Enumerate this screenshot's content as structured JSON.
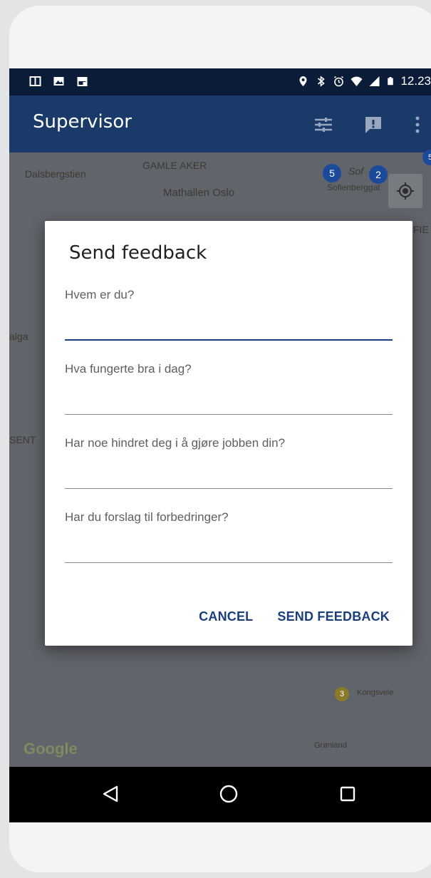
{
  "status_bar": {
    "time": "12.23",
    "left_icons": [
      "notification-tile-icon",
      "image-icon",
      "store-icon"
    ],
    "right_icons": [
      "location-pin-icon",
      "bluetooth-icon",
      "alarm-icon",
      "wifi-icon",
      "signal-icon",
      "battery-icon"
    ]
  },
  "app_bar": {
    "title": "Supervisor",
    "actions": [
      "filter-sliders-icon",
      "feedback-icon",
      "more-vert-icon"
    ]
  },
  "map": {
    "labels": [
      "Dalsbergstien",
      "GAMLE AKER",
      "Mathallen Oslo",
      "Sof",
      "Sofienberggat",
      "FIE",
      "alga",
      "SENT",
      "Kongsvele",
      "Grønland"
    ],
    "clusters": [
      "5",
      "2",
      "3",
      "5"
    ],
    "logo": "Google"
  },
  "dialog": {
    "title": "Send feedback",
    "fields": [
      {
        "label": "Hvem er du?",
        "value": ""
      },
      {
        "label": "Hva fungerte bra i dag?",
        "value": ""
      },
      {
        "label": "Har noe hindret deg i å gjøre jobben din?",
        "value": ""
      },
      {
        "label": "Har du forslag til forbedringer?",
        "value": ""
      }
    ],
    "cancel_label": "CANCEL",
    "send_label": "SEND FEEDBACK"
  },
  "colors": {
    "app_bar": "#1a3a6a",
    "status_bar": "#0b1c38",
    "accent": "#1a3f7c"
  }
}
